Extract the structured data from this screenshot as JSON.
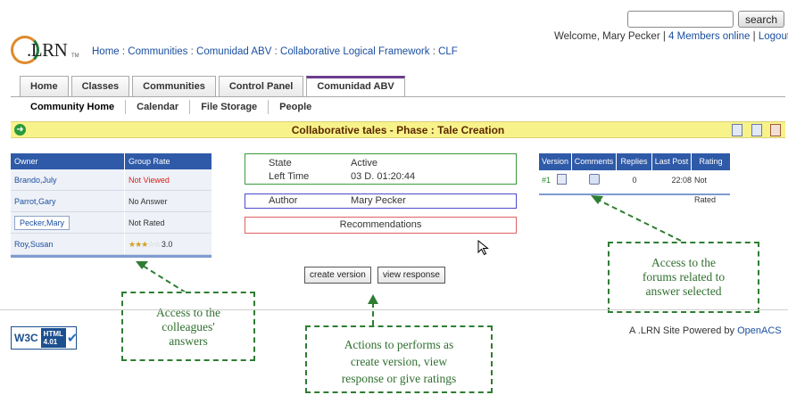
{
  "header": {
    "search": {
      "value": "",
      "button_label": "search"
    },
    "welcome_text": "Welcome, Mary Pecker |",
    "members_link": "4 Members online",
    "logout_sep": "|",
    "logout_link": "Logout",
    "logo_text": ".LRN",
    "logo_tm": "TM",
    "breadcrumb": [
      "Home",
      "Communities",
      "Comunidad ABV",
      "Collaborative Logical Framework",
      "CLF"
    ],
    "breadcrumb_sep": ":"
  },
  "tabs": [
    {
      "label": "Home"
    },
    {
      "label": "Classes"
    },
    {
      "label": "Communities"
    },
    {
      "label": "Control Panel"
    },
    {
      "label": "Comunidad ABV",
      "active": true
    }
  ],
  "subtabs": [
    {
      "label": "Community Home",
      "active": true
    },
    {
      "label": "Calendar"
    },
    {
      "label": "File Storage"
    },
    {
      "label": "People"
    }
  ],
  "title_bar": {
    "title": "Collaborative tales - Phase : Tale Creation"
  },
  "owner_table": {
    "headers": [
      "Owner",
      "Group Rate"
    ],
    "rows": [
      {
        "owner": "Brando,July",
        "rate": "Not Viewed"
      },
      {
        "owner": "Parrot,Gary",
        "rate": "No Answer"
      },
      {
        "owner": "Pecker,Mary",
        "rate": "Not Rated"
      },
      {
        "owner": "Roy,Susan",
        "rate": "3.0",
        "stars": 3,
        "stars_max": 5
      }
    ]
  },
  "state_box": {
    "state_label": "State",
    "state_value": "Active",
    "time_label": "Left Time",
    "time_value": "03 D. 01:20:44"
  },
  "author_box": {
    "label": "Author",
    "value": "Mary Pecker"
  },
  "recommendations": "Recommendations",
  "actions": {
    "create": "create version",
    "view": "view response"
  },
  "versions_table": {
    "headers": [
      "Version",
      "Comments",
      "Replies",
      "Last Post",
      "Rating"
    ],
    "row": {
      "version": "#1",
      "replies": "0",
      "last_post": "22:08",
      "rating": "Not Rated"
    }
  },
  "annotations": {
    "forums": [
      "Access to the",
      "forums related to",
      "answer selected"
    ],
    "colleagues": [
      "Access to the",
      "colleagues'",
      "answers"
    ],
    "actions": [
      "Actions to performs as",
      "create version, view",
      "response or give ratings"
    ]
  },
  "footer": {
    "w3c": "W3C",
    "html_badge": [
      "HTML",
      "4.01"
    ],
    "powered_text": "A .LRN Site Powered by",
    "powered_link": "OpenACS"
  }
}
